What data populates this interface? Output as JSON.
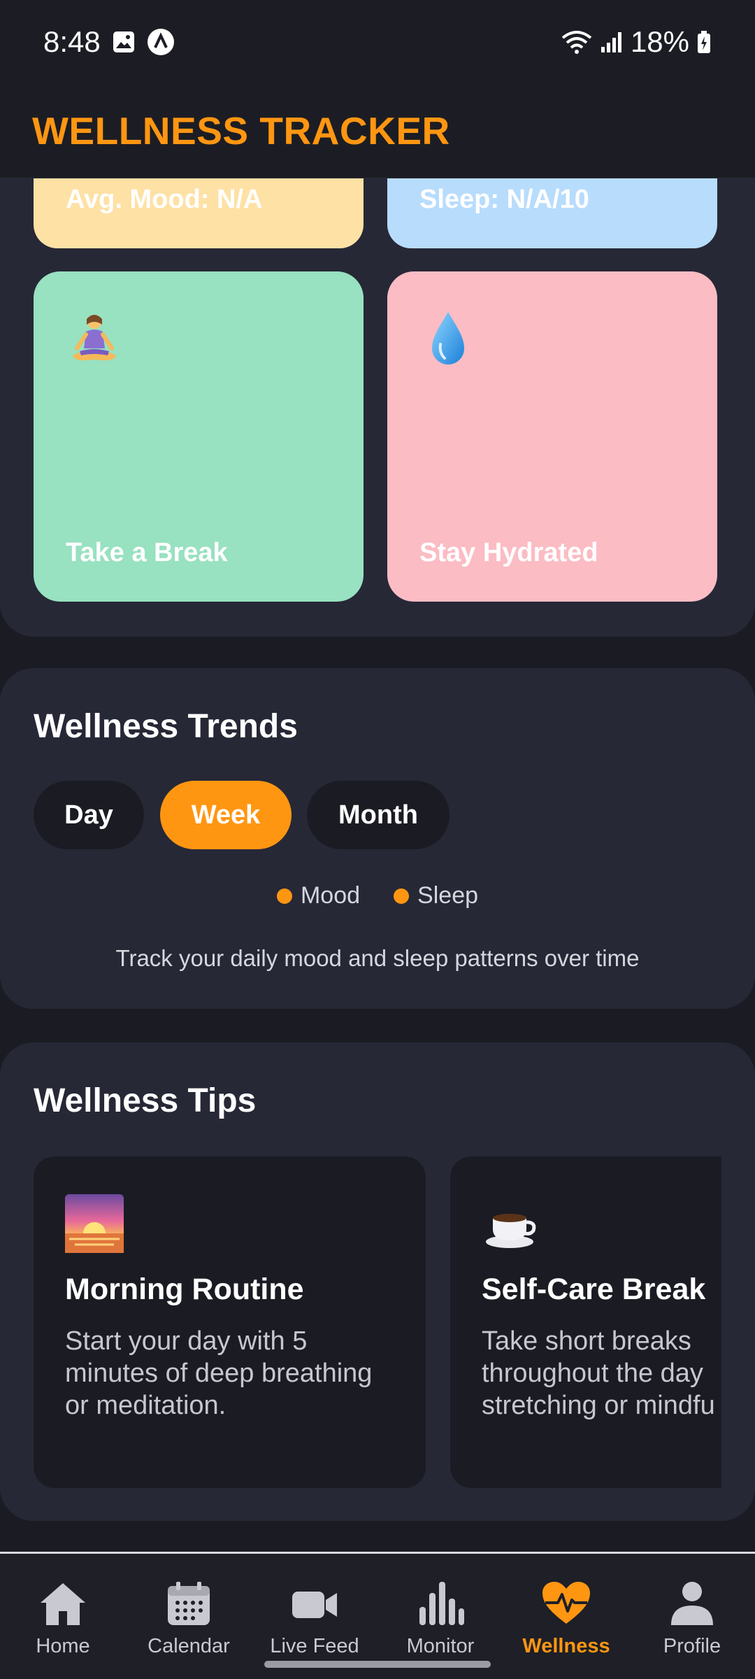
{
  "status_bar": {
    "time": "8:48",
    "battery": "18%",
    "icons": [
      "gallery-icon",
      "app-badge-icon",
      "wifi-icon",
      "signal-icon",
      "battery-charging-icon"
    ]
  },
  "header": {
    "title": "WELLNESS TRACKER"
  },
  "summary": {
    "mood_label": "Avg. Mood: N/A",
    "sleep_label": "Sleep: N/A/10"
  },
  "actions": [
    {
      "label": "Take a Break",
      "icon": "meditation-icon",
      "color": "#98e1c1"
    },
    {
      "label": "Stay Hydrated",
      "icon": "water-drop-icon",
      "color": "#fbbcc4"
    }
  ],
  "trends": {
    "title": "Wellness Trends",
    "ranges": [
      "Day",
      "Week",
      "Month"
    ],
    "selected_range": "Week",
    "legend": [
      "Mood",
      "Sleep"
    ],
    "description": "Track your daily mood and sleep patterns over time"
  },
  "tips": {
    "title": "Wellness Tips",
    "items": [
      {
        "icon": "sunrise-icon",
        "title": "Morning Routine",
        "text": "Start your day with 5 minutes of deep breathing or meditation."
      },
      {
        "icon": "coffee-icon",
        "title": "Self-Care Break",
        "text": "Take short breaks throughout the day stretching or mindfu"
      }
    ]
  },
  "nav": {
    "items": [
      {
        "label": "Home",
        "icon": "home-icon"
      },
      {
        "label": "Calendar",
        "icon": "calendar-icon"
      },
      {
        "label": "Live Feed",
        "icon": "video-camera-icon"
      },
      {
        "label": "Monitor",
        "icon": "bar-chart-icon"
      },
      {
        "label": "Wellness",
        "icon": "heart-pulse-icon"
      },
      {
        "label": "Profile",
        "icon": "user-icon"
      }
    ],
    "active": "Wellness"
  },
  "colors": {
    "accent": "#ff9612",
    "background": "#1b1c23",
    "panel": "#262836"
  }
}
